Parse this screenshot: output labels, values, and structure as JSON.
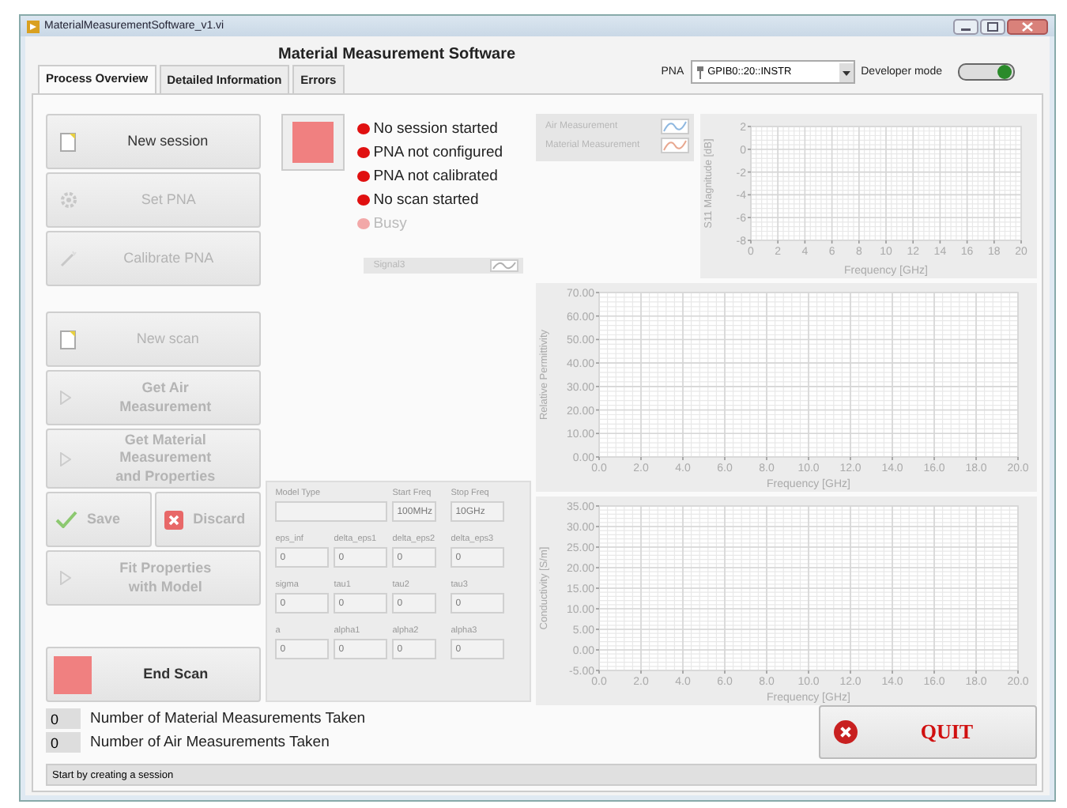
{
  "window": {
    "title": "MaterialMeasurementSoftware_v1.vi"
  },
  "header": "Material Measurement Software",
  "tabs": [
    {
      "label": "Process Overview",
      "selected": true
    },
    {
      "label": "Detailed Information",
      "selected": false
    },
    {
      "label": "Errors",
      "selected": false
    }
  ],
  "pna": {
    "label": "PNA",
    "value": "GPIB0::20::INSTR"
  },
  "developer_mode": {
    "label": "Developer mode",
    "on": true
  },
  "buttons": [
    {
      "kind": "single",
      "label": "New session",
      "disabled": false
    },
    {
      "kind": "single",
      "label": "Set PNA",
      "disabled": true
    },
    {
      "kind": "single",
      "label": "Calibrate PNA",
      "disabled": true
    },
    {
      "kind": "single",
      "label": "New scan",
      "disabled": true
    },
    {
      "kind": "single",
      "label": "Get Air\nMeasurement",
      "disabled": true
    },
    {
      "kind": "single",
      "label": "Get Material\nMeasurement\nand Properties",
      "disabled": true
    },
    {
      "kind": "pair",
      "items": [
        {
          "label": "Save",
          "disabled": true
        },
        {
          "label": "Discard",
          "disabled": true
        }
      ]
    },
    {
      "kind": "single",
      "label": "Fit Properties\nwith Model",
      "disabled": true
    },
    {
      "kind": "single",
      "label": "End Scan",
      "disabled": false
    }
  ],
  "status_leds": [
    {
      "label": "No session started",
      "on": true
    },
    {
      "label": "PNA not configured",
      "on": true
    },
    {
      "label": "PNA not calibrated",
      "on": true
    },
    {
      "label": "No scan started",
      "on": true
    },
    {
      "label": "Busy",
      "on": false
    }
  ],
  "model": {
    "model_type": {
      "label": "Model Type"
    },
    "start_freq": {
      "label": "Start Freq",
      "value": "100MHz"
    },
    "stop_freq": {
      "label": "Stop Freq",
      "value": "10GHz"
    },
    "params": [
      {
        "label": "eps_inf",
        "value": "0"
      },
      {
        "label": "delta_eps1",
        "value": "0"
      },
      {
        "label": "delta_eps2",
        "value": "0"
      },
      {
        "label": "delta_eps3",
        "value": "0"
      },
      {
        "label": "sigma",
        "value": "0"
      },
      {
        "label": "tau1",
        "value": "0"
      },
      {
        "label": "tau2",
        "value": "0"
      },
      {
        "label": "tau3",
        "value": "0"
      },
      {
        "label": "a",
        "value": "0"
      },
      {
        "label": "alpha1",
        "value": "0"
      },
      {
        "label": "alpha2",
        "value": "0"
      },
      {
        "label": "alpha3",
        "value": "0"
      }
    ]
  },
  "charts": [
    {
      "legend": [
        {
          "name": "Air Measurement",
          "color": "#8fb8e0"
        },
        {
          "name": "Material Measurement",
          "color": "#e8a890"
        }
      ],
      "chart_data": {
        "type": "line",
        "grid": true,
        "xlabel": "Frequency [GHz]",
        "ylabel": "S11 Magnitude [dB]",
        "xlim": [
          0,
          20
        ],
        "ylim": [
          -8,
          2
        ],
        "xticks": [
          0,
          2,
          4,
          6,
          8,
          10,
          12,
          14,
          16,
          18,
          20
        ],
        "yticks": [
          2,
          0,
          -2,
          -4,
          -6,
          -8
        ]
      }
    },
    {
      "legend": [
        {
          "name": "Signal3"
        }
      ],
      "chart_data": {
        "type": "line",
        "grid": true,
        "xlabel": "Frequency [GHz]",
        "ylabel": "Relative Permittivity",
        "xlim": [
          0,
          20
        ],
        "ylim": [
          0,
          70
        ],
        "xticks": [
          {
            "value": 0,
            "label": "0.0"
          },
          {
            "value": 2,
            "label": "2.0"
          },
          {
            "value": 4,
            "label": "4.0"
          },
          {
            "value": 6,
            "label": "6.0"
          },
          {
            "value": 8,
            "label": "8.0"
          },
          {
            "value": 10,
            "label": "10.0"
          },
          {
            "value": 12,
            "label": "12.0"
          },
          {
            "value": 14,
            "label": "14.0"
          },
          {
            "value": 16,
            "label": "16.0"
          },
          {
            "value": 18,
            "label": "18.0"
          },
          {
            "value": 20,
            "label": "20.0"
          }
        ],
        "yticks": [
          {
            "value": 70,
            "label": "70.00"
          },
          {
            "value": 60,
            "label": "60.00"
          },
          {
            "value": 50,
            "label": "50.00"
          },
          {
            "value": 40,
            "label": "40.00"
          },
          {
            "value": 30,
            "label": "30.00"
          },
          {
            "value": 20,
            "label": "20.00"
          },
          {
            "value": 10,
            "label": "10.00"
          },
          {
            "value": 0,
            "label": "0.00"
          }
        ]
      }
    },
    {
      "chart_data": {
        "type": "line",
        "grid": true,
        "xlabel": "Frequency [GHz]",
        "ylabel": "Conductivity [S/m]",
        "xlim": [
          0,
          20
        ],
        "ylim": [
          -5,
          35
        ],
        "xticks": [
          {
            "value": 0,
            "label": "0.0"
          },
          {
            "value": 2,
            "label": "2.0"
          },
          {
            "value": 4,
            "label": "4.0"
          },
          {
            "value": 6,
            "label": "6.0"
          },
          {
            "value": 8,
            "label": "8.0"
          },
          {
            "value": 10,
            "label": "10.0"
          },
          {
            "value": 12,
            "label": "12.0"
          },
          {
            "value": 14,
            "label": "14.0"
          },
          {
            "value": 16,
            "label": "16.0"
          },
          {
            "value": 18,
            "label": "18.0"
          },
          {
            "value": 20,
            "label": "20.0"
          }
        ],
        "yticks": [
          {
            "value": 35,
            "label": "35.00"
          },
          {
            "value": 30,
            "label": "30.00"
          },
          {
            "value": 25,
            "label": "25.00"
          },
          {
            "value": 20,
            "label": "20.00"
          },
          {
            "value": 15,
            "label": "15.00"
          },
          {
            "value": 10,
            "label": "10.00"
          },
          {
            "value": 5,
            "label": "5.00"
          },
          {
            "value": 0,
            "label": "0.00"
          },
          {
            "value": -5,
            "label": "-5.00"
          }
        ]
      }
    }
  ],
  "counters": [
    {
      "value": "0",
      "label": "Number of Material Measurements Taken"
    },
    {
      "value": "0",
      "label": "Number of Air Measurements Taken"
    }
  ],
  "quit_button": {
    "label": "QUIT"
  },
  "status_bar": "Start by creating a session"
}
